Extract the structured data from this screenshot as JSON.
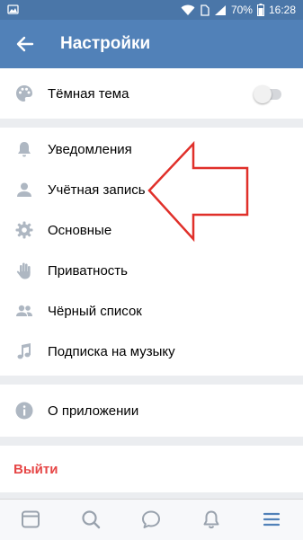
{
  "status_bar": {
    "battery": "70%",
    "time": "16:28"
  },
  "header": {
    "title": "Настройки"
  },
  "dark_theme": {
    "label": "Тёмная тема",
    "enabled": false
  },
  "menu": {
    "notifications": "Уведомления",
    "account": "Учётная запись",
    "general": "Основные",
    "privacy": "Приватность",
    "blacklist": "Чёрный список",
    "music_subscription": "Подписка на музыку"
  },
  "about": {
    "label": "О приложении"
  },
  "logout": {
    "label": "Выйти"
  },
  "colors": {
    "header": "#5181b8",
    "status_bar": "#4a76a8",
    "logout": "#e64646",
    "annotation_arrow": "#e0302a",
    "active_nav": "#5181b8"
  },
  "bottom_nav": [
    "newsfeed-icon",
    "search-icon",
    "messages-icon",
    "notifications-icon",
    "menu-icon"
  ]
}
